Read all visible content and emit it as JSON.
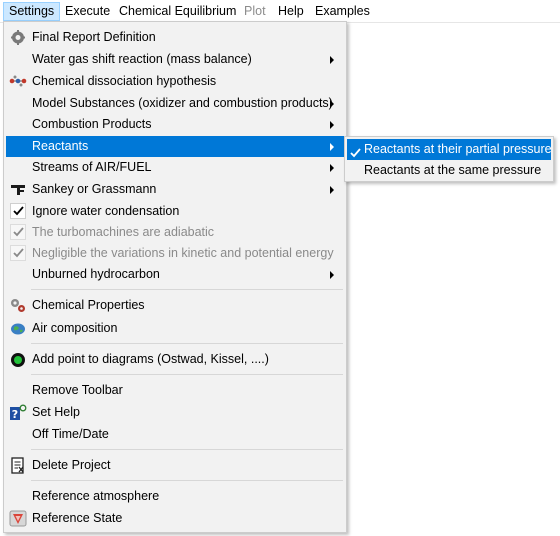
{
  "menubar": {
    "items": [
      {
        "label": "Settings",
        "state": "active"
      },
      {
        "label": "Execute",
        "state": "normal"
      },
      {
        "label": "Chemical Equilibrium",
        "state": "normal"
      },
      {
        "label": "Plot",
        "state": "disabled"
      },
      {
        "label": "Help",
        "state": "normal"
      },
      {
        "label": "Examples",
        "state": "normal"
      }
    ]
  },
  "settings_menu": {
    "items": [
      {
        "label": "Final Report Definition",
        "icon": "report-settings-icon"
      },
      {
        "label": "Water gas shift reaction (mass balance)",
        "submenu": true
      },
      {
        "label": "Chemical dissociation hypothesis",
        "icon": "molecule-icon"
      },
      {
        "label": "Model Substances (oxidizer and combustion products)",
        "submenu": true
      },
      {
        "label": "Combustion Products",
        "submenu": true
      },
      {
        "label": "Reactants",
        "submenu": true,
        "highlighted": true
      },
      {
        "label": "Streams of AIR/FUEL",
        "submenu": true
      },
      {
        "label": "Sankey or Grassmann",
        "submenu": true,
        "icon": "sankey-icon"
      },
      {
        "label": "Ignore water condensation",
        "checked": true
      },
      {
        "label": "The turbomachines are adiabatic",
        "checked": true,
        "disabled": true
      },
      {
        "label": "Negligible the variations in kinetic and potential energy",
        "checked": true,
        "disabled": true
      },
      {
        "label": "Unburned hydrocarbon",
        "submenu": true
      },
      {
        "label": "Chemical Properties",
        "icon": "gears-icon"
      },
      {
        "label": "Air composition",
        "icon": "globe-icon"
      },
      {
        "label": "Add point to diagrams (Ostwad, Kissel, ....)",
        "icon": "green-dot-icon"
      },
      {
        "label": "Remove Toolbar"
      },
      {
        "label": "Set Help",
        "icon": "help-icon"
      },
      {
        "label": "Off Time/Date"
      },
      {
        "label": "Delete Project",
        "icon": "delete-document-icon"
      },
      {
        "label": "Reference atmosphere"
      },
      {
        "label": "Reference State",
        "icon": "reference-state-icon"
      }
    ]
  },
  "reactants_submenu": {
    "items": [
      {
        "label": "Reactants at their partial pressure",
        "checked": true,
        "highlighted": true
      },
      {
        "label": "Reactants at the same pressure"
      }
    ]
  },
  "colors": {
    "highlight": "#0078d7",
    "menu_background": "#f2f2f2",
    "active_menubar": "#cce8ff"
  }
}
